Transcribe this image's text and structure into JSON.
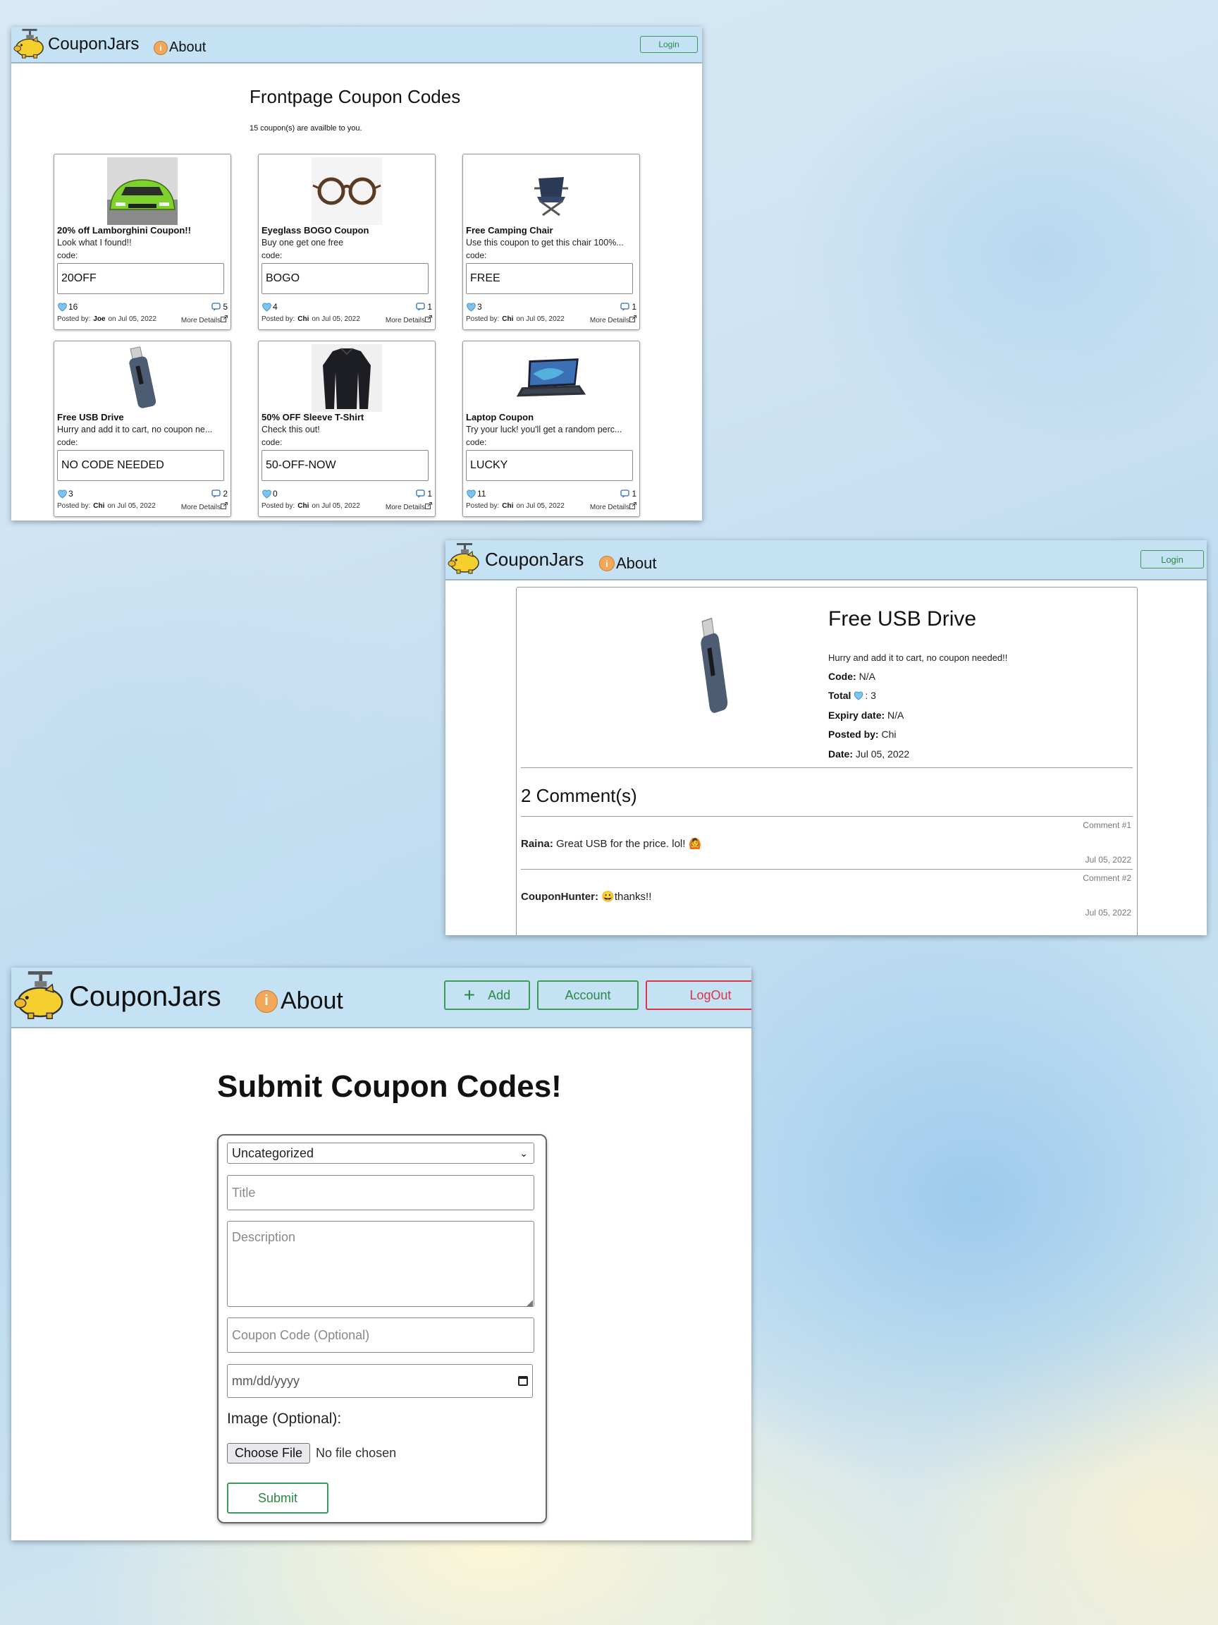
{
  "brand": "CouponJars",
  "about": "About",
  "login": "Login",
  "frontpage": {
    "title": "Frontpage Coupon Codes",
    "count_text": "15 coupon(s) are availble to you.",
    "code_label": "code:",
    "posted_by_label": "Posted by:",
    "on_label": "on",
    "more_label": "More Details",
    "cards": [
      {
        "title": "20% off Lamborghini Coupon!!",
        "desc": "Look what I found!!",
        "code": "20OFF",
        "likes": "16",
        "comments": "5",
        "user": "Joe",
        "date": "Jul 05, 2022",
        "image": "green-sports-car"
      },
      {
        "title": "Eyeglass BOGO Coupon",
        "desc": "Buy one get one free",
        "code": "BOGO",
        "likes": "4",
        "comments": "1",
        "user": "Chi",
        "date": "Jul 05, 2022",
        "image": "eyeglasses"
      },
      {
        "title": "Free Camping Chair",
        "desc": "Use this coupon to get this chair 100%...",
        "code": "FREE",
        "likes": "3",
        "comments": "1",
        "user": "Chi",
        "date": "Jul 05, 2022",
        "image": "camping-chair"
      },
      {
        "title": "Free USB Drive",
        "desc": "Hurry and add it to cart, no coupon ne...",
        "code": "NO CODE NEEDED",
        "likes": "3",
        "comments": "2",
        "user": "Chi",
        "date": "Jul 05, 2022",
        "image": "usb-drive"
      },
      {
        "title": "50% OFF Sleeve T-Shirt",
        "desc": "Check this out!",
        "code": "50-OFF-NOW",
        "likes": "0",
        "comments": "1",
        "user": "Chi",
        "date": "Jul 05, 2022",
        "image": "black-shirt"
      },
      {
        "title": "Laptop Coupon",
        "desc": "Try your luck! you'll get a random perc...",
        "code": "LUCKY",
        "likes": "11",
        "comments": "1",
        "user": "Chi",
        "date": "Jul 05, 2022",
        "image": "laptop"
      }
    ]
  },
  "detail": {
    "title": "Free USB Drive",
    "desc": "Hurry and add it to cart, no coupon needed!!",
    "code_label": "Code:",
    "code": "N/A",
    "total_label": "Total",
    "total": ": 3",
    "expiry_label": "Expiry date:",
    "expiry": "N/A",
    "posted_label": "Posted by:",
    "posted": "Chi",
    "date_label": "Date:",
    "date": "Jul 05, 2022",
    "comments_title": "2 Comment(s)",
    "comments": [
      {
        "num": "Comment #1",
        "user": "Raina:",
        "text": "Great USB for the price. lol! 🙆",
        "date": "Jul 05, 2022"
      },
      {
        "num": "Comment #2",
        "user": "CouponHunter:",
        "text": "😀thanks!!",
        "date": "Jul 05, 2022"
      }
    ]
  },
  "submit": {
    "nav_add": "Add",
    "nav_account": "Account",
    "nav_logout": "LogOut",
    "title": "Submit Coupon Codes!",
    "category": "Uncategorized",
    "title_placeholder": "Title",
    "desc_placeholder": "Description",
    "code_placeholder": "Coupon Code (Optional)",
    "date_placeholder": "mm/dd/yyyy",
    "image_label": "Image (Optional):",
    "choose_file": "Choose File",
    "no_file": "No file chosen",
    "submit_label": "Submit"
  },
  "colors": {
    "nav_bg": "#c4e2f4",
    "accent_green": "#3c9b58",
    "danger": "#dc3545",
    "heart": "#7cc3ee",
    "info_orange": "#f2a85a"
  }
}
